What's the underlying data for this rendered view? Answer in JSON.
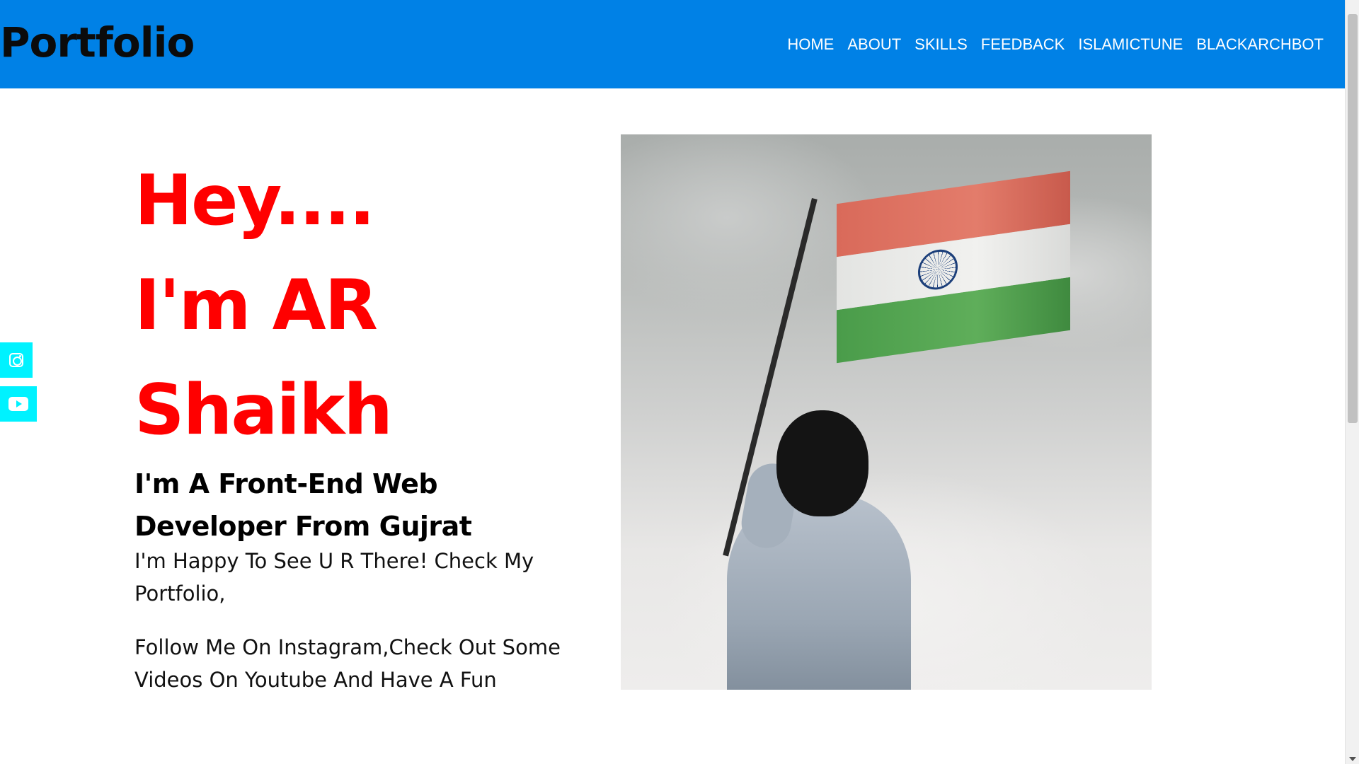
{
  "navbar": {
    "brand": "Portfolio",
    "links": [
      "HOME",
      "ABOUT",
      "SKILLS",
      "FEEDBACK",
      "ISLAMICTUNE",
      "BLACKARCHBOT"
    ]
  },
  "social": [
    {
      "name": "instagram",
      "icon": "instagram-icon"
    },
    {
      "name": "youtube",
      "icon": "youtube-icon"
    }
  ],
  "hero": {
    "greeting_line1": "Hey....",
    "greeting_line2": "I'm AR",
    "greeting_line3": "Shaikh",
    "role_line1": "I'm A Front-End Web",
    "role_line2": "Developer From Gujrat",
    "intro": "I'm Happy To See U R There! Check My Portfolio,",
    "follow": "Follow Me On Instagram,Check Out Some Videos On Youtube And Have A Fun"
  },
  "colors": {
    "navbar_bg": "#0081e6",
    "heading_red": "#ff0000",
    "social_bg": "#00f2ff"
  }
}
